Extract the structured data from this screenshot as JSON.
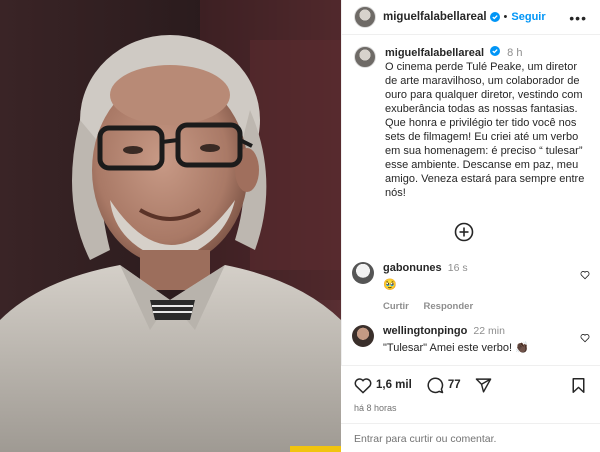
{
  "header": {
    "username": "miguelfalabellareal",
    "follow_label": "Seguir",
    "more_label": "•••"
  },
  "caption": {
    "username": "miguelfalabellareal",
    "time": "8 h",
    "text": "O cinema perde Tulé Peake, um diretor de arte maravilhoso, um colaborador de ouro para qualquer diretor, vestindo com exuberância todas as nossas fantasias. Que honra e privilégio ter tido você nos sets de filmagem! Eu criei até um verbo em sua homenagem: é preciso “ tulesar” esse ambiente. Descanse em paz, meu amigo. Veneza estará para sempre entre nós!"
  },
  "comments": [
    {
      "username": "gabonunes",
      "time": "16 s",
      "text": "🥹",
      "reply_label": "Curtir",
      "answer_label": "Responder"
    },
    {
      "username": "wellingtonpingo",
      "time": "22 min",
      "text": "\"Tulesar\" Amei este verbo! 👏🏿"
    }
  ],
  "actions": {
    "likes": "1,6 mil",
    "comments": "77",
    "time_ago": "há 8 horas",
    "enter_label": "Entrar",
    "add_comment_text": "para curtir ou comentar."
  },
  "icons": {
    "verified": "verified-badge-icon",
    "plus": "plus-circle-icon",
    "heart": "heart-icon",
    "comment": "comment-icon",
    "share": "share-icon",
    "bookmark": "bookmark-icon"
  },
  "colors": {
    "accent": "#0095f6",
    "muted": "#8e8e8e"
  }
}
